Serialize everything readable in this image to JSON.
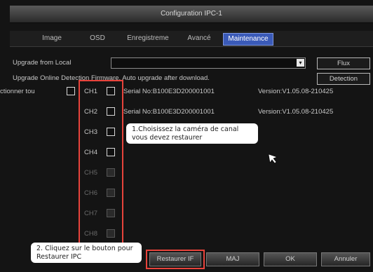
{
  "window": {
    "title": "Configuration IPC-1"
  },
  "tabs": [
    {
      "label": "Image"
    },
    {
      "label": "OSD"
    },
    {
      "label": "Enregistreme"
    },
    {
      "label": "Avancé"
    },
    {
      "label": "Maintenance"
    }
  ],
  "upgrade": {
    "local_label": "Upgrade from Local",
    "local_value": "",
    "flux_button": "Flux",
    "online_text": "Upgrade Online  Detection Firmware. Auto upgrade after download.",
    "detection_button": "Detection"
  },
  "select_all": {
    "label": "ctionner tou"
  },
  "channels": [
    {
      "label": "CH1",
      "serial": "Serial No:B100E3D200001001",
      "version": "Version:V1.05.08-210425"
    },
    {
      "label": "CH2",
      "serial": "Serial No:B100E3D200001001",
      "version": "Version:V1.05.08-210425"
    },
    {
      "label": "CH3"
    },
    {
      "label": "CH4"
    },
    {
      "label": "CH5"
    },
    {
      "label": "CH6"
    },
    {
      "label": "CH7"
    },
    {
      "label": "CH8"
    }
  ],
  "buttons": {
    "restore": "Restaurer IF",
    "maj": "MAJ",
    "ok": "OK",
    "cancel": "Annuler"
  },
  "callouts": {
    "step1": "1.Choisissez la caméra de canal vous devez restaurer",
    "step2": "2. Cliquez sur le bouton pour Restaurer IPC"
  },
  "colors": {
    "highlight": "#e8433b",
    "active_tab": "#3a5ab8"
  }
}
